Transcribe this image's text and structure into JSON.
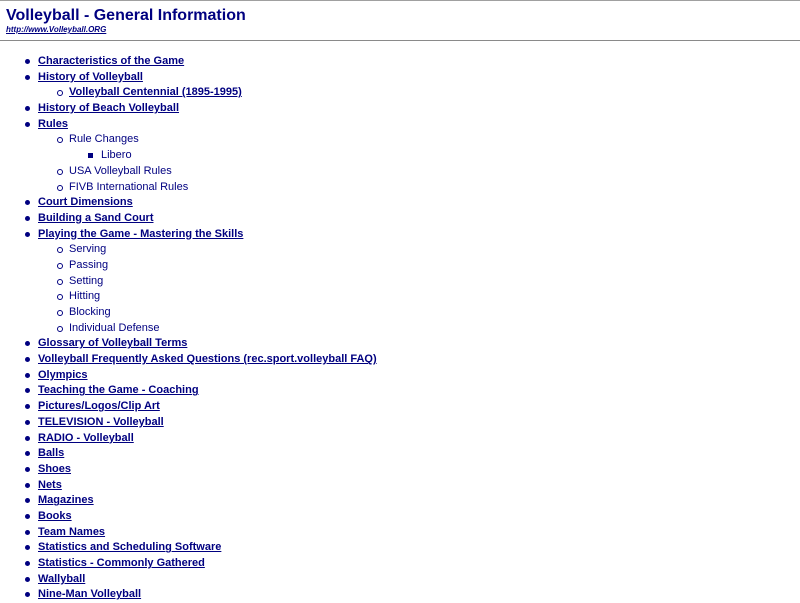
{
  "header": {
    "title": "Volleyball - General Information",
    "url": "http://www.Volleyball.ORG"
  },
  "nav": [
    {
      "label": "Characteristics of the Game",
      "level": 0,
      "link": true
    },
    {
      "label": "History of Volleyball",
      "level": 0,
      "link": true
    },
    {
      "label": "Volleyball Centennial (1895-1995)",
      "level": 1,
      "link": true
    },
    {
      "label": "History of Beach Volleyball",
      "level": 0,
      "link": true
    },
    {
      "label": "Rules",
      "level": 0,
      "link": true
    },
    {
      "label": "Rule Changes",
      "level": 1,
      "link": false
    },
    {
      "label": "Libero",
      "level": 2,
      "link": false
    },
    {
      "label": "USA Volleyball Rules",
      "level": 1,
      "link": false
    },
    {
      "label": "FIVB International Rules",
      "level": 1,
      "link": false
    },
    {
      "label": "Court Dimensions",
      "level": 0,
      "link": true
    },
    {
      "label": "Building a Sand Court",
      "level": 0,
      "link": true
    },
    {
      "label": "Playing the Game - Mastering the Skills",
      "level": 0,
      "link": true
    },
    {
      "label": "Serving",
      "level": 1,
      "link": false
    },
    {
      "label": "Passing",
      "level": 1,
      "link": false
    },
    {
      "label": "Setting",
      "level": 1,
      "link": false
    },
    {
      "label": "Hitting",
      "level": 1,
      "link": false
    },
    {
      "label": "Blocking",
      "level": 1,
      "link": false
    },
    {
      "label": "Individual Defense",
      "level": 1,
      "link": false
    },
    {
      "label": "Glossary of Volleyball Terms",
      "level": 0,
      "link": true
    },
    {
      "label": "Volleyball Frequently Asked Questions (rec.sport.volleyball FAQ)",
      "level": 0,
      "link": true
    },
    {
      "label": "Olympics",
      "level": 0,
      "link": true
    },
    {
      "label": "Teaching the Game - Coaching",
      "level": 0,
      "link": true
    },
    {
      "label": "Pictures/Logos/Clip Art",
      "level": 0,
      "link": true
    },
    {
      "label": "TELEVISION - Volleyball",
      "level": 0,
      "link": true
    },
    {
      "label": "RADIO - Volleyball",
      "level": 0,
      "link": true
    },
    {
      "label": "Balls",
      "level": 0,
      "link": true
    },
    {
      "label": "Shoes",
      "level": 0,
      "link": true
    },
    {
      "label": "Nets",
      "level": 0,
      "link": true
    },
    {
      "label": "Magazines",
      "level": 0,
      "link": true
    },
    {
      "label": "Books",
      "level": 0,
      "link": true
    },
    {
      "label": "Team Names",
      "level": 0,
      "link": true
    },
    {
      "label": "Statistics and Scheduling Software",
      "level": 0,
      "link": true
    },
    {
      "label": "Statistics - Commonly Gathered",
      "level": 0,
      "link": true
    },
    {
      "label": "Wallyball",
      "level": 0,
      "link": true
    },
    {
      "label": "Nine-Man Volleyball",
      "level": 0,
      "link": true
    }
  ]
}
